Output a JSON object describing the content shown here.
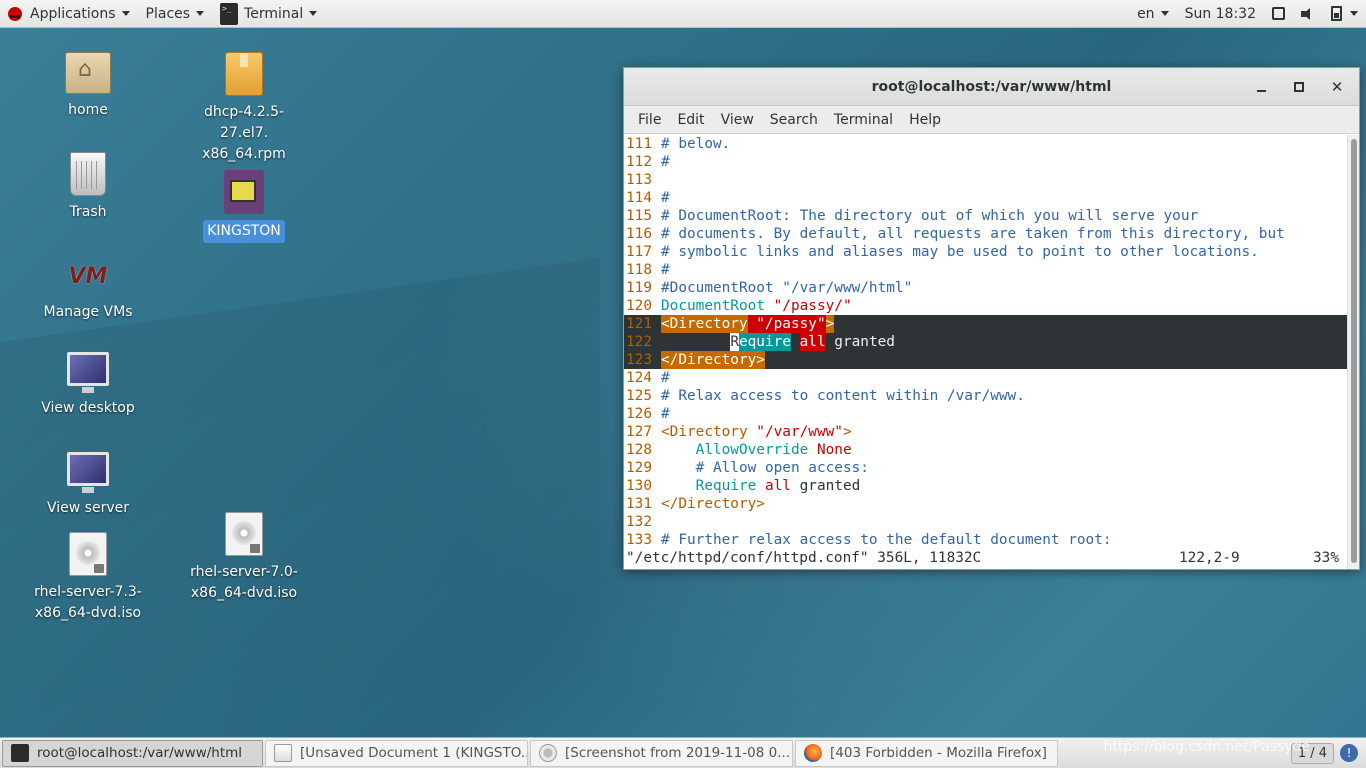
{
  "top_panel": {
    "applications_label": "Applications",
    "places_label": "Places",
    "terminal_label": "Terminal",
    "language": "en",
    "clock": "Sun 18:32"
  },
  "desktop": {
    "icons": [
      {
        "name": "home",
        "label": "home",
        "icon": "home-folder-icon"
      },
      {
        "name": "dhcp-rpm",
        "label_line1": "dhcp-4.2.5-27.el7.",
        "label_line2": "x86_64.rpm",
        "icon": "package-icon"
      },
      {
        "name": "trash",
        "label": "Trash",
        "icon": "trash-icon"
      },
      {
        "name": "kingston",
        "label": "KINGSTON",
        "icon": "usb-drive-icon"
      },
      {
        "name": "manage-vms",
        "label": "Manage VMs",
        "icon": "vmm-logo-icon"
      },
      {
        "name": "view-desktop",
        "label": "View desktop",
        "icon": "monitor-icon"
      },
      {
        "name": "view-server",
        "label": "View server",
        "icon": "monitor-icon"
      },
      {
        "name": "rhel73-iso",
        "label_line1": "rhel-server-7.3-",
        "label_line2": "x86_64-dvd.iso",
        "icon": "disc-image-icon"
      },
      {
        "name": "rhel70-iso",
        "label_line1": "rhel-server-7.0-",
        "label_line2": "x86_64-dvd.iso",
        "icon": "disc-image-icon"
      }
    ]
  },
  "terminal": {
    "title": "root@localhost:/var/www/html",
    "menu": [
      "File",
      "Edit",
      "View",
      "Search",
      "Terminal",
      "Help"
    ],
    "lines": [
      {
        "n": "111",
        "text": "# below."
      },
      {
        "n": "112",
        "text": "#"
      },
      {
        "n": "113",
        "text": ""
      },
      {
        "n": "114",
        "text": "#"
      },
      {
        "n": "115",
        "text": "# DocumentRoot: The directory out of which you will serve your"
      },
      {
        "n": "116",
        "text": "# documents. By default, all requests are taken from this directory, but"
      },
      {
        "n": "117",
        "text": "# symbolic links and aliases may be used to point to other locations."
      },
      {
        "n": "118",
        "text": "#"
      },
      {
        "n": "119",
        "text": "#DocumentRoot \"/var/www/html\""
      },
      {
        "n": "120",
        "key": "DocumentRoot",
        "value": " \"/passy/\""
      },
      {
        "n": "121",
        "tag": "<Directory",
        "value": " \"/passy\"",
        "close": ">"
      },
      {
        "n": "122",
        "indent": "        ",
        "cursor": "R",
        "key_rest": "equire",
        "space": " ",
        "op": "all",
        "rest": " granted"
      },
      {
        "n": "123",
        "tag": "</Directory>"
      },
      {
        "n": "124",
        "text": "#"
      },
      {
        "n": "125",
        "text": "# Relax access to content within /var/www."
      },
      {
        "n": "126",
        "text": "#"
      },
      {
        "n": "127",
        "tag": "<Directory",
        "value": " \"/var/www\"",
        "close": ">"
      },
      {
        "n": "128",
        "indent": "    ",
        "key": "AllowOverride",
        "value": " None"
      },
      {
        "n": "129",
        "indent": "    ",
        "text": "# Allow open access:"
      },
      {
        "n": "130",
        "indent": "    ",
        "key": "Require",
        "op": " all",
        "rest": " granted"
      },
      {
        "n": "131",
        "tag": "</Directory>"
      },
      {
        "n": "132",
        "text": ""
      },
      {
        "n": "133",
        "text": "# Further relax access to the default document root:"
      }
    ],
    "status_file": "\"/etc/httpd/conf/httpd.conf\" 356L, 11832C",
    "status_pos": "122,2-9",
    "status_pct": "33%"
  },
  "taskbar": {
    "tasks": [
      {
        "label": "root@localhost:/var/www/html",
        "icon": "terminal-icon",
        "active": true
      },
      {
        "label": "[Unsaved Document 1 (KINGSTO...",
        "icon": "text-editor-icon",
        "active": false
      },
      {
        "label": "[Screenshot from 2019-11-08 0...",
        "icon": "screenshot-icon",
        "active": false
      },
      {
        "label": "[403 Forbidden - Mozilla Firefox]",
        "icon": "firefox-icon",
        "active": false
      }
    ],
    "workspace": "1 / 4",
    "watermark": "https://blog.csdn.net/Passyde"
  },
  "colors": {
    "desktop_bg": "#2f6f88",
    "line_number": "#b35c00",
    "comment": "#3465a4",
    "keyword": "#06989a",
    "string": "#cc0000",
    "highlight_bg": "#2e3436"
  }
}
